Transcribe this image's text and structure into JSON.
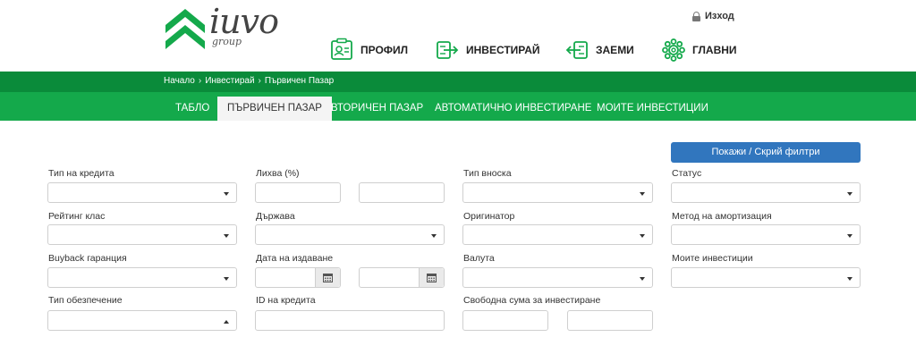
{
  "header": {
    "logo_text": "iuvo",
    "logo_sub": "group",
    "logout_label": "Изход",
    "nav": [
      {
        "label": "ПРОФИЛ",
        "icon": "profile-card-icon"
      },
      {
        "label": "ИНВЕСТИРАЙ",
        "icon": "invest-arrow-icon"
      },
      {
        "label": "ЗАЕМИ",
        "icon": "loans-arrow-icon"
      },
      {
        "label": "ГЛАВНИ",
        "icon": "main-gear-icon"
      }
    ]
  },
  "breadcrumb": {
    "items": [
      "Начало",
      "Инвестирай",
      "Първичен Пазар"
    ],
    "separator": "›"
  },
  "subnav": {
    "tabs": [
      "ТАБЛО",
      "ПЪРВИЧЕН ПАЗАР",
      "ВТОРИЧЕН ПАЗАР",
      "АВТОМАТИЧНО ИНВЕСТИРАНЕ",
      "МОИТЕ ИНВЕСТИЦИИ"
    ],
    "active_tab": "ПЪРВИЧЕН ПАЗАР"
  },
  "filters": {
    "toggle_label": "Покажи / Скрий филтри",
    "labels": {
      "credit_type": "Тип на кредита",
      "interest": "Лихва (%)",
      "installment_type": "Тип вноска",
      "status": "Статус",
      "rating_class": "Рейтинг клас",
      "country": "Държава",
      "originator": "Оригинатор",
      "amortization_method": "Метод на амортизация",
      "buyback": "Buyback гаранция",
      "issue_date": "Дата на издаване",
      "currency": "Валута",
      "my_investments": "Моите инвестиции",
      "collateral_type": "Тип обезпечение",
      "credit_id": "ID на кредита",
      "free_amount": "Свободна сума за инвестиране"
    }
  },
  "colors": {
    "brand_green_dark": "#0a8b3a",
    "brand_green": "#14a94b",
    "button_blue": "#3176be"
  }
}
